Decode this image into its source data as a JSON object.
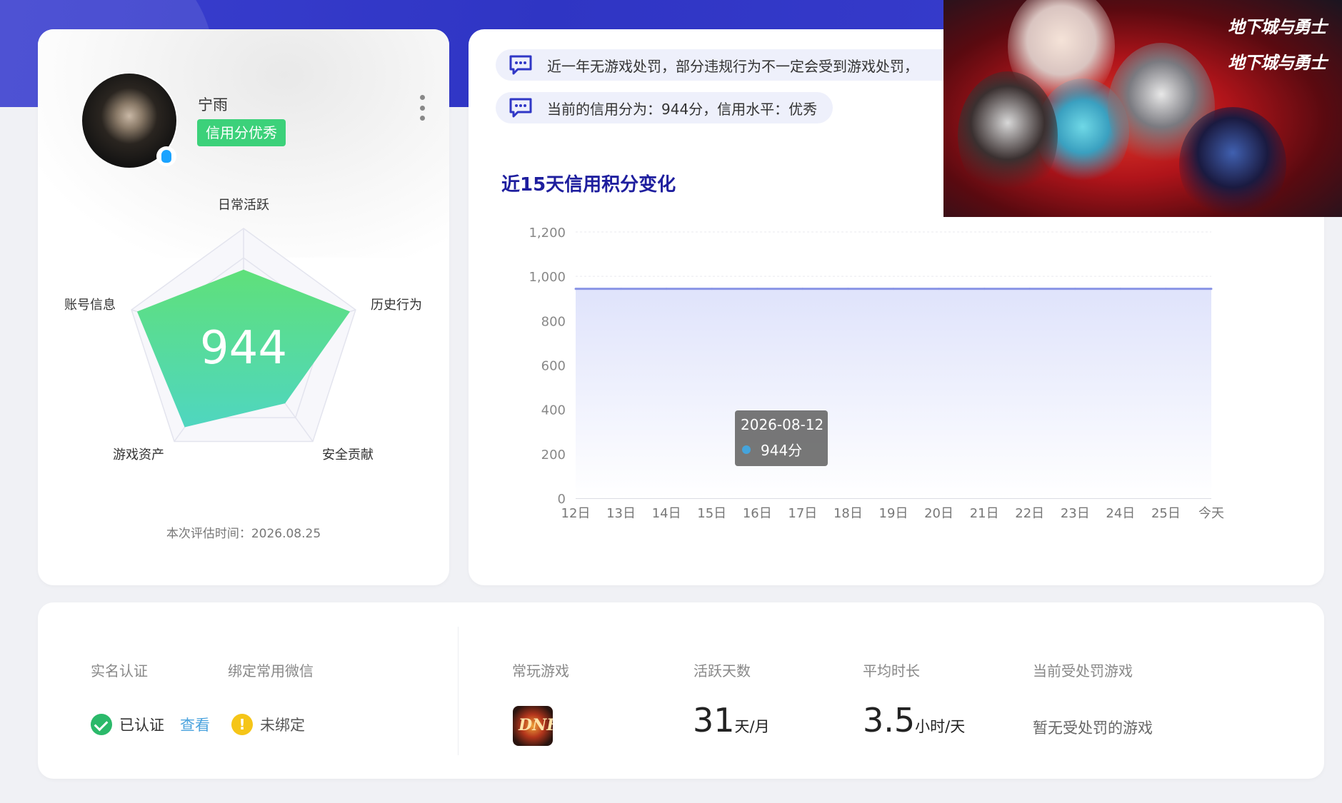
{
  "profile": {
    "user_name": "宁雨",
    "credit_tag": "信用分优秀",
    "score": "944",
    "radar_labels": {
      "daily_active": "日常活跃",
      "history": "历史行为",
      "security": "安全贡献",
      "assets": "游戏资产",
      "account": "账号信息"
    },
    "radar_values": [
      0.65,
      0.95,
      0.6,
      0.85,
      0.95
    ],
    "eval_time": "本次评估时间：2026.08.25"
  },
  "notices": [
    "近一年无游戏处罚，部分违规行为不一定会受到游戏处罚，",
    "当前的信用分为：944分，信用水平：优秀"
  ],
  "chart_title": "近15天信用积分变化",
  "tooltip": {
    "date": "2026-08-12",
    "value": "944分"
  },
  "chart_data": {
    "type": "area",
    "title": "近15天信用积分变化",
    "categories": [
      "12日",
      "13日",
      "14日",
      "15日",
      "16日",
      "17日",
      "18日",
      "19日",
      "20日",
      "21日",
      "22日",
      "23日",
      "24日",
      "25日",
      "今天"
    ],
    "values": [
      944,
      944,
      944,
      944,
      944,
      944,
      944,
      944,
      944,
      944,
      944,
      944,
      944,
      944,
      944
    ],
    "ylim": [
      0,
      1200
    ],
    "yticks": [
      "0",
      "200",
      "400",
      "600",
      "800",
      "1,000",
      "1,200"
    ],
    "grid": true
  },
  "banner": {
    "logo_text": [
      "地下城与勇士",
      "地下城与勇士"
    ]
  },
  "info": {
    "real_name_label": "实名认证",
    "wechat_label": "绑定常用微信",
    "verified_text": "已认证",
    "view_link": "查看",
    "unbound_text": "未绑定",
    "common_game_label": "常玩游戏",
    "common_game_icon_text": "DNF",
    "active_days_label": "活跃天数",
    "active_days_value": "31",
    "active_days_unit": "天/月",
    "avg_time_label": "平均时长",
    "avg_time_value": "3.5",
    "avg_time_unit": "小时/天",
    "punished_label": "当前受处罚游戏",
    "punished_value": "暂无受处罚的游戏"
  },
  "colors": {
    "accent": "#3037c6",
    "credit_green": "#3cd17a",
    "line": "#8a95e6",
    "title": "#1e1e9e"
  }
}
